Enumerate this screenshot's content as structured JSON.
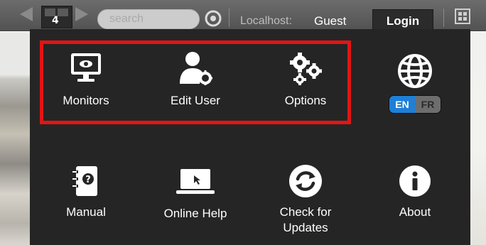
{
  "toolbar": {
    "grid_count": "4",
    "search_placeholder": "search",
    "host_label": "Localhost:",
    "user_name": "Guest",
    "login_label": "Login"
  },
  "menu": {
    "items": [
      {
        "label": "Monitors",
        "icon": "monitor-icon"
      },
      {
        "label": "Edit User",
        "icon": "edit-user-icon"
      },
      {
        "label": "Options",
        "icon": "gears-icon"
      },
      {
        "label": "Manual",
        "icon": "manual-icon"
      },
      {
        "label": "Online Help",
        "icon": "laptop-icon"
      },
      {
        "label": "Check for Updates",
        "icon": "refresh-icon"
      },
      {
        "label": "About",
        "icon": "info-icon"
      }
    ],
    "language": {
      "icon": "globe-icon",
      "options": [
        "EN",
        "FR"
      ],
      "selected": "EN"
    }
  },
  "colors": {
    "panel": "#252525",
    "highlight": "#e31414",
    "accent": "#1e7fd6"
  }
}
